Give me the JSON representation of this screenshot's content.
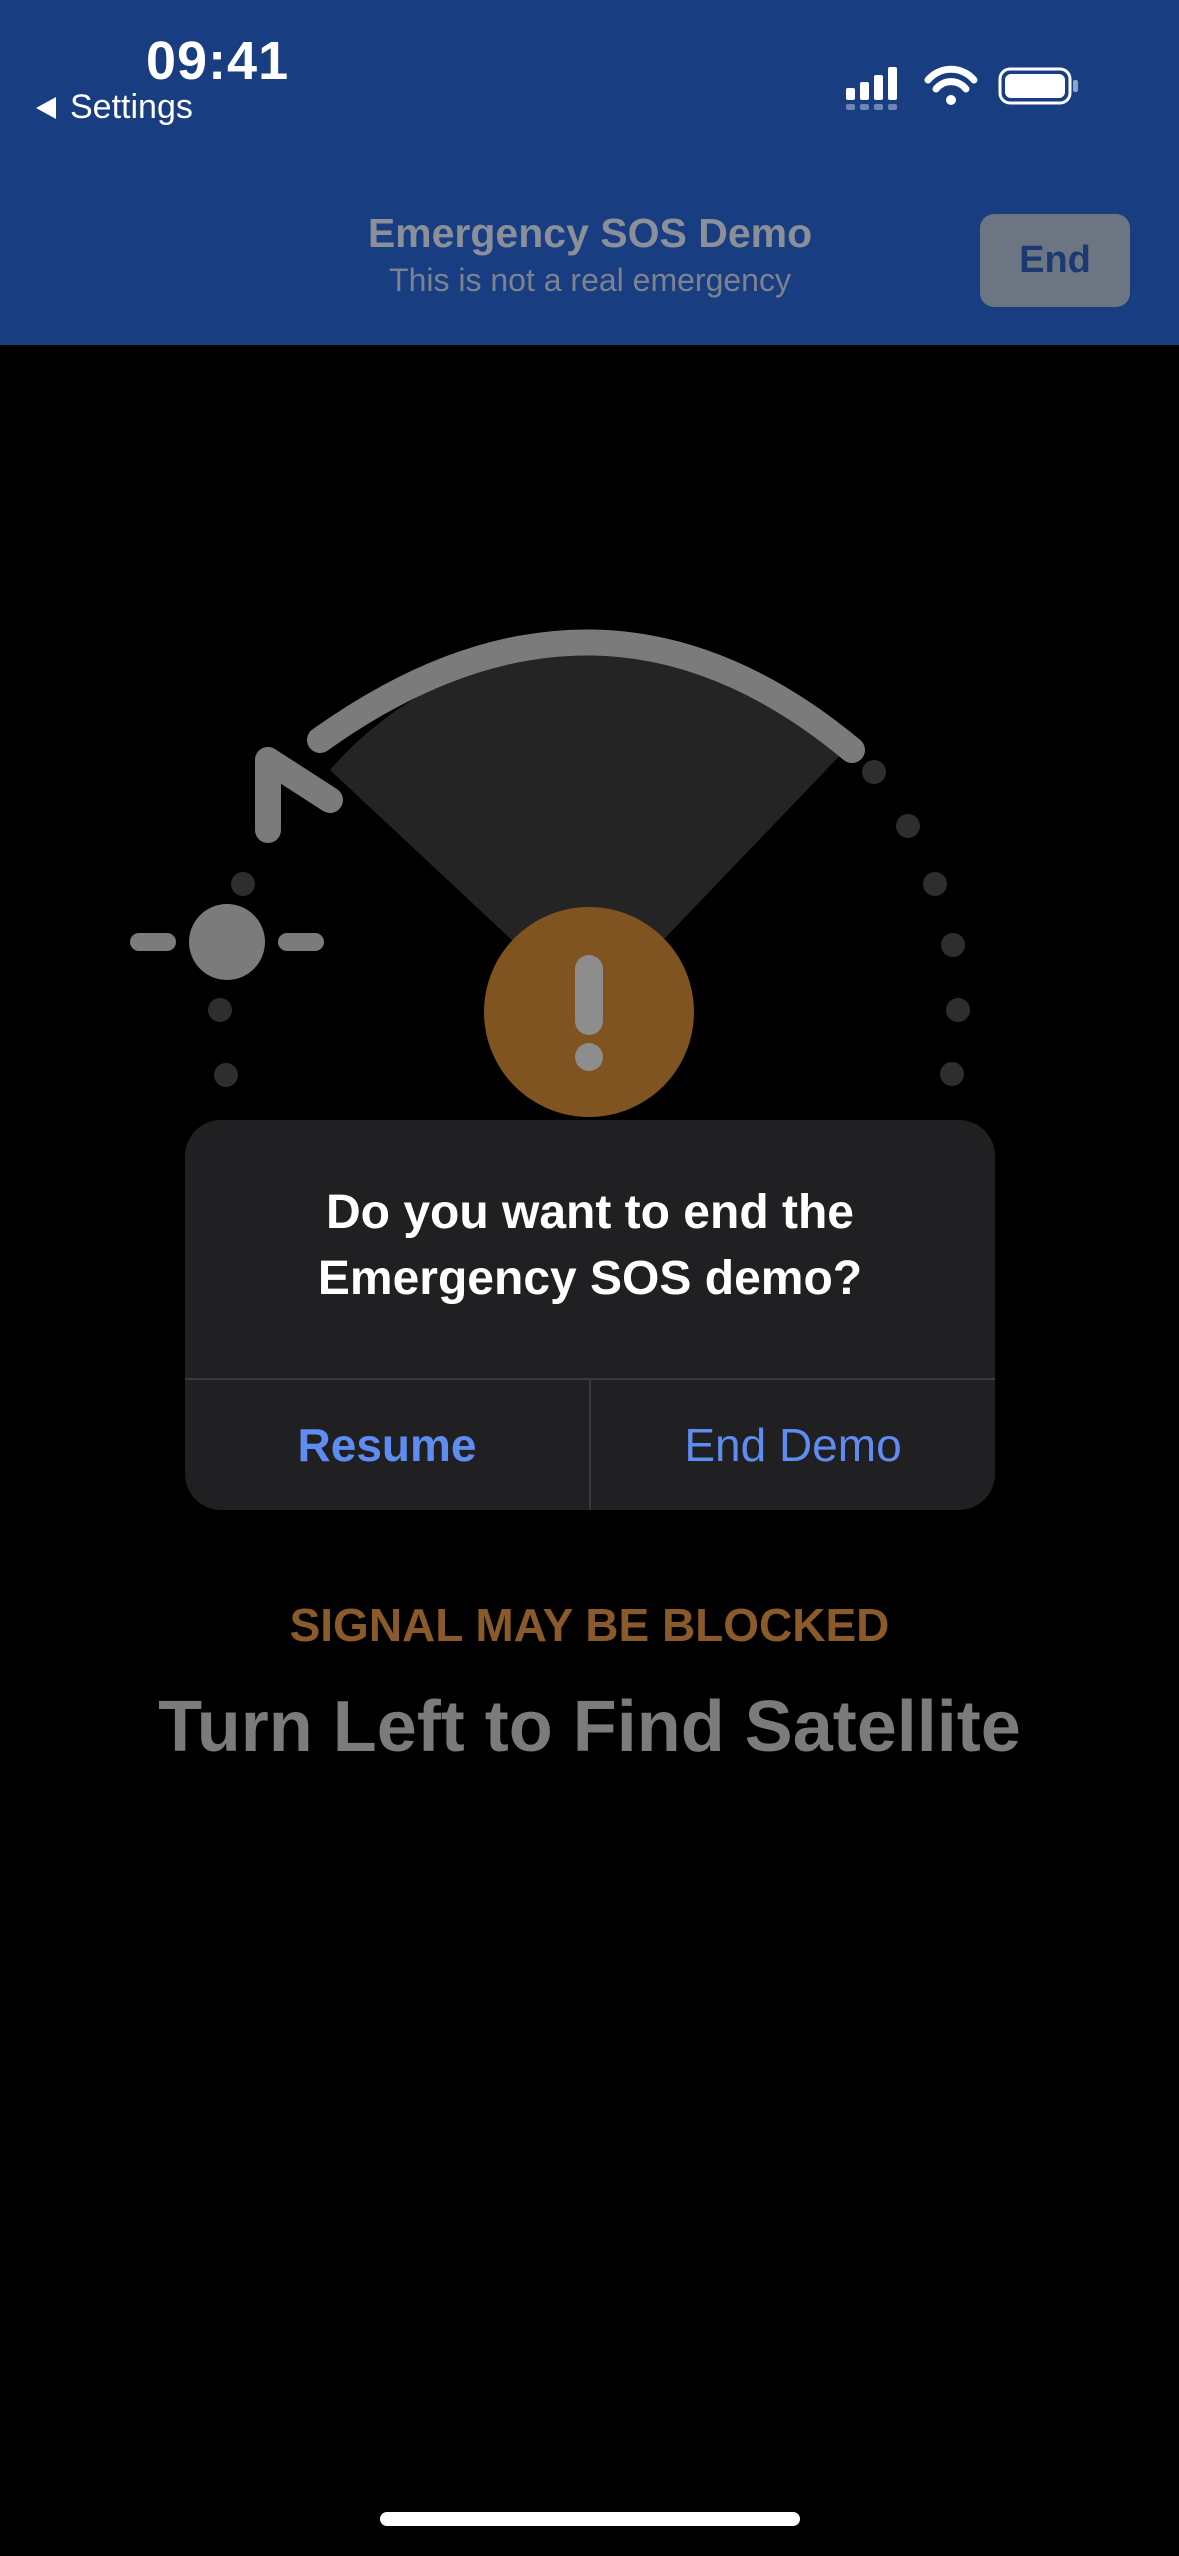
{
  "status_bar": {
    "time": "09:41",
    "back_label": "Settings",
    "icons": [
      "cellular-signal-icon",
      "wifi-icon",
      "battery-icon"
    ]
  },
  "nav": {
    "title": "Emergency SOS Demo",
    "subtitle": "This is not a real emergency",
    "end_label": "End"
  },
  "illustration": {
    "icons": [
      "turn-left-arrow-icon",
      "satellite-sun-icon",
      "warning-exclamation-icon"
    ]
  },
  "alert": {
    "message": "Do you want to end the Emergency SOS demo?",
    "resume_label": "Resume",
    "end_demo_label": "End Demo"
  },
  "status": {
    "warning": "SIGNAL MAY BE BLOCKED",
    "instruction": "Turn Left to Find Satellite"
  },
  "colors": {
    "header_bg": "#183d80",
    "accent_blue": "#5e8cf0",
    "warning_orange": "#8a5a2a",
    "warning_circle": "#7f5420"
  }
}
